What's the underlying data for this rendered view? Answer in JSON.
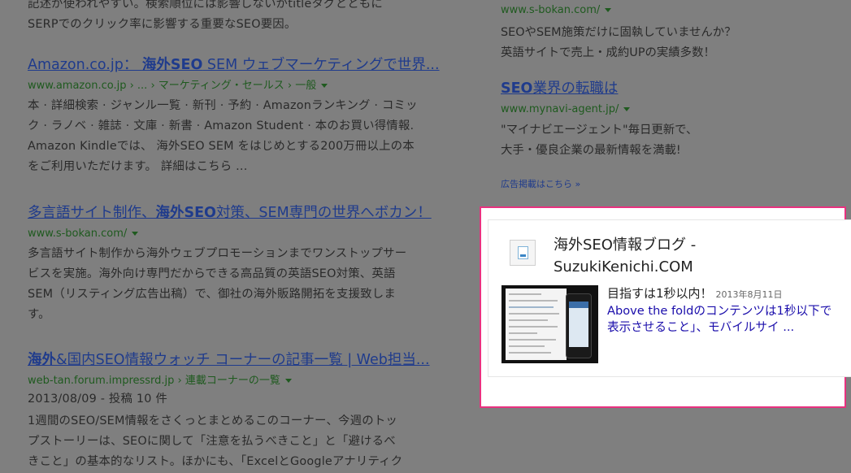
{
  "left_results": {
    "top_snippet": {
      "line1": "記述が使われやすい。検索順位には影響しないがtitleタグとともに",
      "line2": "SERPでのクリック率に影響する重要なSEO要因。"
    },
    "results": [
      {
        "title_pre": "Amazon.co.jp： ",
        "title_bold": "海外SEO",
        "title_post": " SEM ウェブマーケティングで世界...",
        "url": "www.amazon.co.jp › ... › マーケティング・セールス › 一般",
        "snippet": [
          "本 · 詳細検索 · ジャンル一覧 · 新刊 · 予約 · Amazonランキング · コミッ",
          "ク · ラノベ · 雑誌 · 文庫 · 新書 · Amazon Student · 本のお買い得情報.",
          "Amazon Kindleでは、 海外SEO SEM をはじめとする200万冊以上の本",
          "をご利用いただけます。 詳細はこちら ..."
        ]
      },
      {
        "title_pre": "多言語サイト制作、",
        "title_bold": "海外SEO",
        "title_post": "対策、SEM専門の世界へボカン！",
        "url": "www.s-bokan.com/",
        "snippet": [
          "多言語サイト制作から海外ウェブプロモーションまでワンストップサー",
          "ビスを実施。海外向け専門だからできる高品質の英語SEO対策、英語",
          "SEM（リスティング広告出稿）で、御社の海外販路開拓を支援致しま",
          "す。"
        ]
      },
      {
        "title_pre": "",
        "title_bold": "海外",
        "title_post": "&国内SEO情報ウォッチ コーナーの記事一覧 | Web担当...",
        "url": "web-tan.forum.impressrd.jp › 連載コーナーの一覧",
        "meta": "2013/08/09 - 投稿 10 件",
        "snippet": [
          "1週間のSEO/SEM情報をさくっとまとめるこのコーナー、今週のトッ",
          "プストーリーは、SEOに関して「注意を払うべきこと」と「避けるべ",
          "きこと」の基本的なリスト。ほかにも、「ExcelとGoogleアナリティク"
        ]
      }
    ]
  },
  "right_ads": {
    "ad1": {
      "url": "www.s-bokan.com/",
      "line1": "SEOやSEM施策だけに固執していませんか？",
      "line2": "英語サイトで売上・成約UPの実績多数！"
    },
    "ad2": {
      "title_bold": "SEO",
      "title_rest": "業界の転職は",
      "url": "www.mynavi-agent.jp/",
      "line1": "\"マイナビエージェント\"毎日更新で、",
      "line2": "大手・優良企業の最新情報を満載!"
    },
    "footer_link": "広告掲載はこちら »"
  },
  "author_card": {
    "title_line1": "海外SEO情報ブログ -",
    "title_line2": "SuzukiKenichi.COM",
    "post_title": "目指すは1秒以内！",
    "post_date": "2013年8月11日",
    "post_link_line1": "Above the foldのコンテンツは1秒以下で",
    "post_link_line2": "表示させること」、モバイルサイ ...",
    "highlight_color": "#e8317f"
  }
}
